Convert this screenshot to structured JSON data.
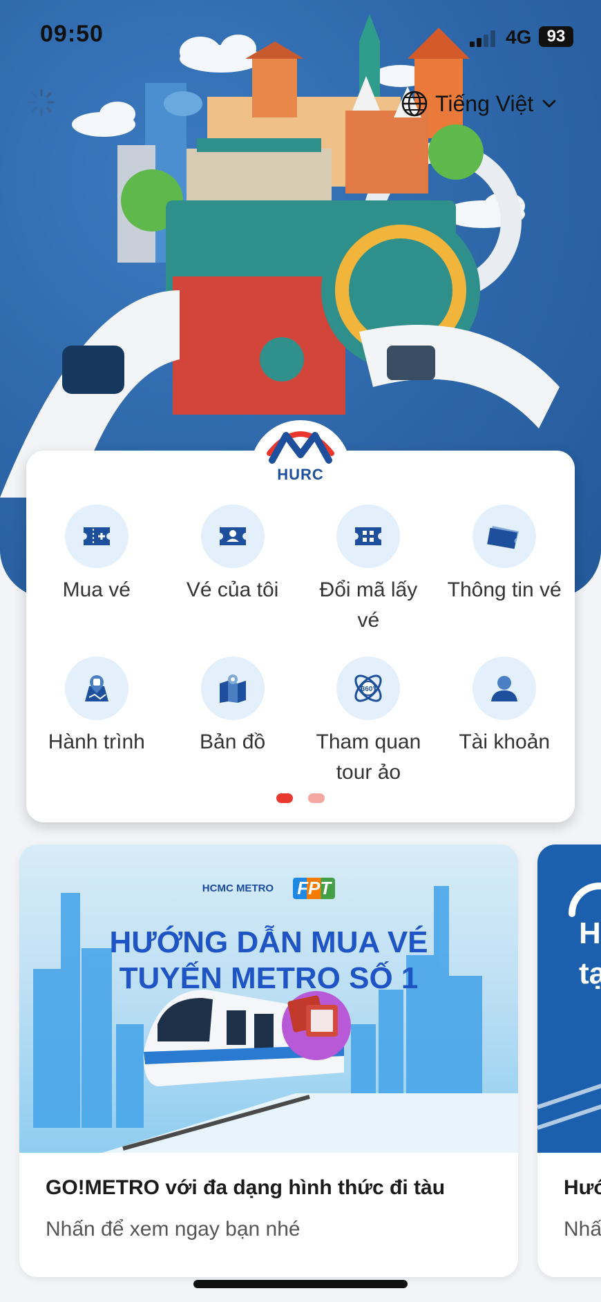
{
  "status_bar": {
    "time": "09:50",
    "network": "4G",
    "battery": "93"
  },
  "header": {
    "language": "Tiếng Việt",
    "language_icon": "globe-icon",
    "dropdown_icon": "chevron-down-icon"
  },
  "logo": {
    "text": "HURC"
  },
  "menu": {
    "items": [
      {
        "label": "Mua vé",
        "icon": "buy-ticket-icon"
      },
      {
        "label": "Vé của tôi",
        "icon": "my-ticket-icon"
      },
      {
        "label": "Đổi mã lấy vé",
        "icon": "redeem-code-icon"
      },
      {
        "label": "Thông tin vé",
        "icon": "ticket-info-icon"
      },
      {
        "label": "Hành trình",
        "icon": "journey-icon"
      },
      {
        "label": "Bản đồ",
        "icon": "map-icon"
      },
      {
        "label": "Tham quan tour ảo",
        "icon": "virtual-tour-360-icon"
      },
      {
        "label": "Tài khoản",
        "icon": "account-icon"
      }
    ],
    "pages": 2,
    "active_page": 1
  },
  "news": [
    {
      "brand_left": "HCMC METRO",
      "brand_right": "FPT",
      "banner_line1": "HƯỚNG DẪN MUA VÉ",
      "banner_line2": "TUYẾN METRO SỐ 1",
      "title": "GO!METRO với đa dạng hình thức đi tàu",
      "subtitle": "Nhấn để xem ngay bạn nhé"
    },
    {
      "banner_line1": "H",
      "banner_line2": "tạ",
      "title": "Hướ",
      "subtitle": "Nhấ"
    }
  ],
  "colors": {
    "brand_blue": "#1d4f9c",
    "brand_red": "#e9372d",
    "icon_bg": "#e3f0fb",
    "hero_bg": "#2d66a8"
  }
}
